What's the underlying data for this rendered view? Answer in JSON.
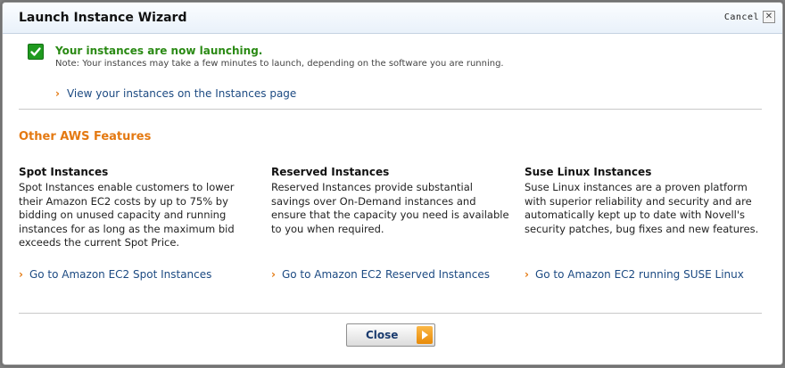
{
  "dialog": {
    "title": "Launch Instance Wizard",
    "cancel_label": "Cancel",
    "close_x": "✕"
  },
  "status": {
    "icon": "checkmark-icon",
    "message": "Your instances are now launching.",
    "note": "Note: Your instances may take a few minutes to launch, depending on the software you are running.",
    "view_link": "View your instances on the Instances page"
  },
  "features": {
    "section_title": "Other AWS Features",
    "items": [
      {
        "title": "Spot Instances",
        "description": "Spot Instances enable customers to lower their Amazon EC2 costs by up to 75% by bidding on unused capacity and running instances for as long as the maximum bid exceeds the current Spot Price.",
        "link": "Go to Amazon EC2 Spot Instances"
      },
      {
        "title": "Reserved Instances",
        "description": "Reserved Instances provide substantial savings over On-Demand instances and ensure that the capacity you need is available to you when required.",
        "link": "Go to Amazon EC2 Reserved Instances"
      },
      {
        "title": "Suse Linux Instances",
        "description": "Suse Linux instances are a proven platform with superior reliability and security and are automatically kept up to date with Novell's security patches, bug fixes and new features.",
        "link": "Go to Amazon EC2 running SUSE Linux"
      }
    ]
  },
  "footer": {
    "close_label": "Close",
    "close_icon": "arrow-right-icon"
  },
  "colors": {
    "accent_orange": "#e47911",
    "success_green": "#2a8a14",
    "link_blue": "#1c4a82"
  }
}
